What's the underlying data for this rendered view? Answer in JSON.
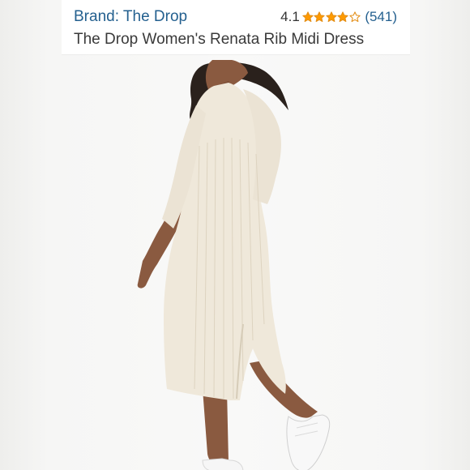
{
  "header": {
    "brand_label": "Brand: The Drop",
    "rating_value": "4.1",
    "rating_stars": 4.1,
    "review_count": "(541)",
    "product_title": "The Drop Women's Renata Rib Midi Dress"
  },
  "colors": {
    "link": "#24608f",
    "title_text": "#3a3a3a",
    "star_fill": "#ff9a00",
    "star_outline": "#e38f18",
    "dress": "#efe8da"
  },
  "icons": {
    "star_full": "star-filled-icon",
    "star_empty": "star-outline-icon"
  }
}
